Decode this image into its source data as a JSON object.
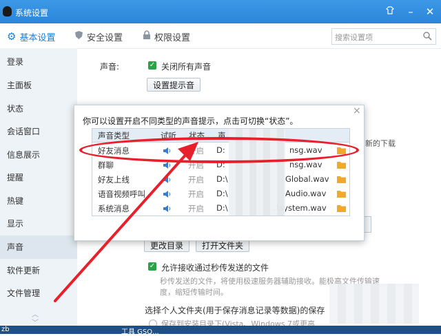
{
  "window": {
    "title": "系统设置"
  },
  "top_tabs": [
    "基本设置",
    "安全设置",
    "权限设置"
  ],
  "search": {
    "placeholder": "搜索设置项"
  },
  "sidebar": {
    "items": [
      "登录",
      "主面板",
      "状态",
      "会话窗口",
      "信息展示",
      "提醒",
      "热键",
      "显示",
      "声音",
      "软件更新",
      "文件管理"
    ],
    "active": "声音"
  },
  "sound": {
    "label": "声音:",
    "mute_all": "关闭所有声音",
    "button": "设置提示音"
  },
  "dialog": {
    "message": "你可以设置开启不同类型的声音提示，点击可切换“状态”。",
    "close": "×",
    "columns": [
      "声音类型",
      "试听",
      "状态",
      "声"
    ],
    "rows": [
      {
        "type": "好友消息",
        "state": "开启",
        "path": "D:",
        "file": "nsg.wav"
      },
      {
        "type": "群聊",
        "state": "开启",
        "path": "D:",
        "file": "nsg.wav"
      },
      {
        "type": "好友上线",
        "state": "开启",
        "path": "D:\\",
        "file": "Global.wav"
      },
      {
        "type": "语音视频呼叫",
        "state": "开启",
        "path": "D:\\",
        "file": "Audio.wav"
      },
      {
        "type": "系统消息",
        "state": "开启",
        "path": "D:\\",
        "file": "..\\system.wav"
      }
    ]
  },
  "file_mgmt": {
    "change_dir": "更改目录",
    "open_folder": "打开文件夹",
    "allow_transfer": "允许接收通过秒传发送的文件",
    "transfer_desc_1": "秒传发送的文件，将使用极速服务器辅助接收。能极高文件传输速",
    "transfer_desc_2": "度，缩短传输时间。",
    "personal_folder": "选择个人文件夹(用于保存消息记录等数据)的保存",
    "save_option": "保存到安装目录下(Vista、Windows 7或更高",
    "partial_right": "新的下载"
  },
  "taskbar": {
    "left": "zb",
    "item": "工具 GSQ..."
  },
  "colors": {
    "accent": "#2a86da",
    "annotation": "#e8202b",
    "check": "#2ba245"
  }
}
